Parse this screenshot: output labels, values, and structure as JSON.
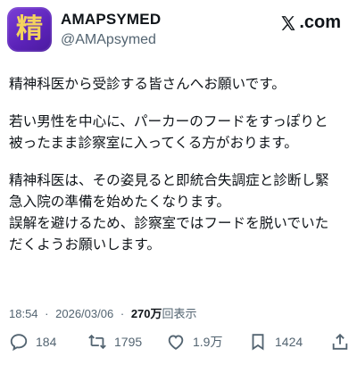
{
  "account": {
    "avatar_glyph": "精",
    "display_name": "AMAPSYMED",
    "handle": "@AMApsymed"
  },
  "brand": {
    "logo_text": ".com"
  },
  "post": {
    "paragraphs": [
      [
        "精神科医から受診する皆さんへお願いです。"
      ],
      [
        "若い男性を中心に、パーカーのフードをすっぽりと",
        "被ったまま診察室に入ってくる方がおります。"
      ],
      [
        "精神科医は、その姿見ると即統合失調症と診断し緊",
        "急入院の準備を始めたくなります。",
        "誤解を避けるため、診察室ではフードを脱いでいた",
        "だくようお願いします。"
      ]
    ]
  },
  "meta": {
    "time": "18:54",
    "separator": "·",
    "date": "2026/03/06",
    "views_count": "270万",
    "views_label": "回表示"
  },
  "actions": {
    "reply_count": "184",
    "retweet_count": "1795",
    "like_count": "1.9万",
    "bookmark_count": "1424"
  },
  "colors": {
    "text": "#0f1419",
    "secondary": "#536471",
    "avatar_bg": "#5b22b8",
    "avatar_glyph": "#f4d35e"
  }
}
